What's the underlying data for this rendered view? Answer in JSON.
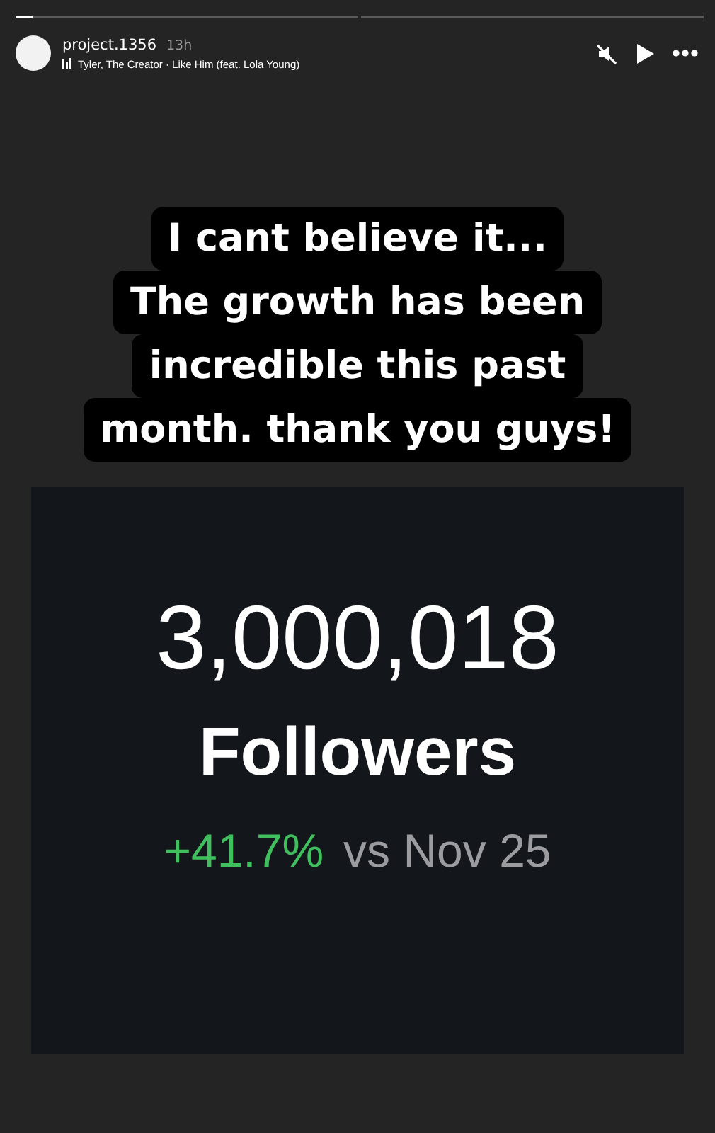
{
  "progress": [
    {
      "viewed": false,
      "level": 0.05
    },
    {
      "viewed": false
    }
  ],
  "header": {
    "username": "project.1356",
    "time": "13h",
    "music": "Tyler, The Creator · Like Him (feat. Lola Young)",
    "muted": true
  },
  "caption": [
    "I cant believe it...",
    "The growth has been",
    "incredible this past",
    "month. thank you guys!"
  ],
  "stats": {
    "count": "3,000,018",
    "label": "Followers",
    "change": "+41.7%",
    "comparison": "vs Nov 25"
  }
}
